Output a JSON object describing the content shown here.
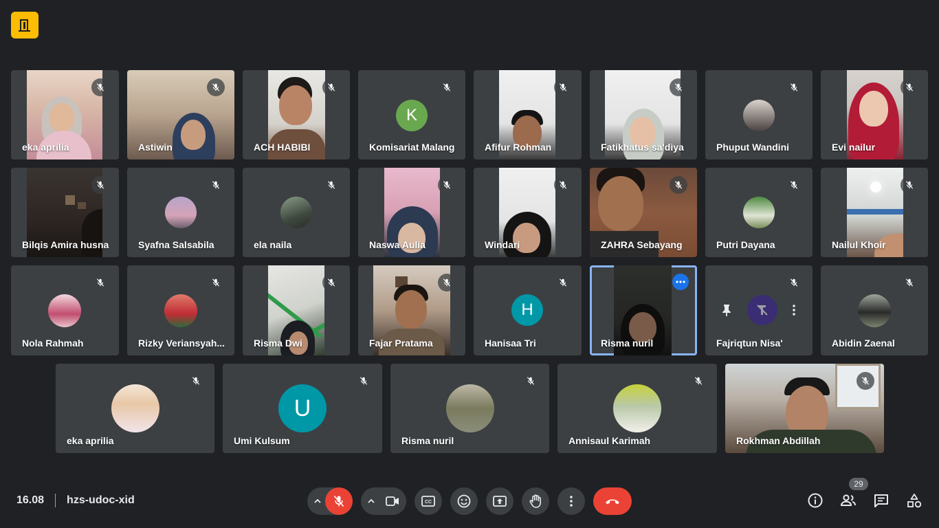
{
  "meeting": {
    "time": "16.08",
    "code": "hzs-udoc-xid",
    "participant_count": "29"
  },
  "grid": {
    "row1": [
      {
        "name": "eka aprilia"
      },
      {
        "name": "Astiwin"
      },
      {
        "name": "ACH HABIBI"
      },
      {
        "name": "Komisariat Malang",
        "initial": "K"
      },
      {
        "name": "Afifur Rohman"
      },
      {
        "name": "Fatikhatus sa'diya"
      },
      {
        "name": "Phuput Wandini"
      },
      {
        "name": "Evi nailur"
      }
    ],
    "row2": [
      {
        "name": "Bilqis Amira husna"
      },
      {
        "name": "Syafna Salsabila"
      },
      {
        "name": "ela naila"
      },
      {
        "name": "Naswa Aulia"
      },
      {
        "name": "Windari"
      },
      {
        "name": "ZAHRA Sebayang"
      },
      {
        "name": "Putri Dayana"
      },
      {
        "name": "Nailul Khoir"
      }
    ],
    "row3": [
      {
        "name": "Nola Rahmah"
      },
      {
        "name": "Rizky Veriansyah..."
      },
      {
        "name": "Risma Dwi"
      },
      {
        "name": "Fajar Pratama"
      },
      {
        "name": "Hanisaa Tri",
        "initial": "H"
      },
      {
        "name": "Risma nuril"
      },
      {
        "name": "Fajriqtun Nisa'"
      },
      {
        "name": "Abidin Zaenal"
      }
    ],
    "row4": [
      {
        "name": "eka aprilia"
      },
      {
        "name": "Umi Kulsum",
        "initial": "U"
      },
      {
        "name": "Risma nuril"
      },
      {
        "name": "Annisaul Karimah"
      },
      {
        "name": "Rokhman Abdillah"
      }
    ]
  },
  "colors": {
    "background": "#202124",
    "tile": "#3c4043",
    "end_call": "#ea4335",
    "active_border": "#8ab4f8",
    "avatar_k": "#6aa84f",
    "avatar_h": "#0097a7",
    "avatar_u": "#0097a7"
  },
  "icons": {
    "logo": "door-icon",
    "muted": "mic-off-icon",
    "camera": "video-icon",
    "captions": "cc-icon",
    "reactions": "emoji-icon",
    "present": "present-icon",
    "raise_hand": "hand-icon",
    "more": "more-vert-icon",
    "end_call": "call-end-icon",
    "info": "info-icon",
    "people": "people-icon",
    "chat": "chat-icon",
    "activities": "shapes-icon",
    "pin": "pin-icon"
  }
}
